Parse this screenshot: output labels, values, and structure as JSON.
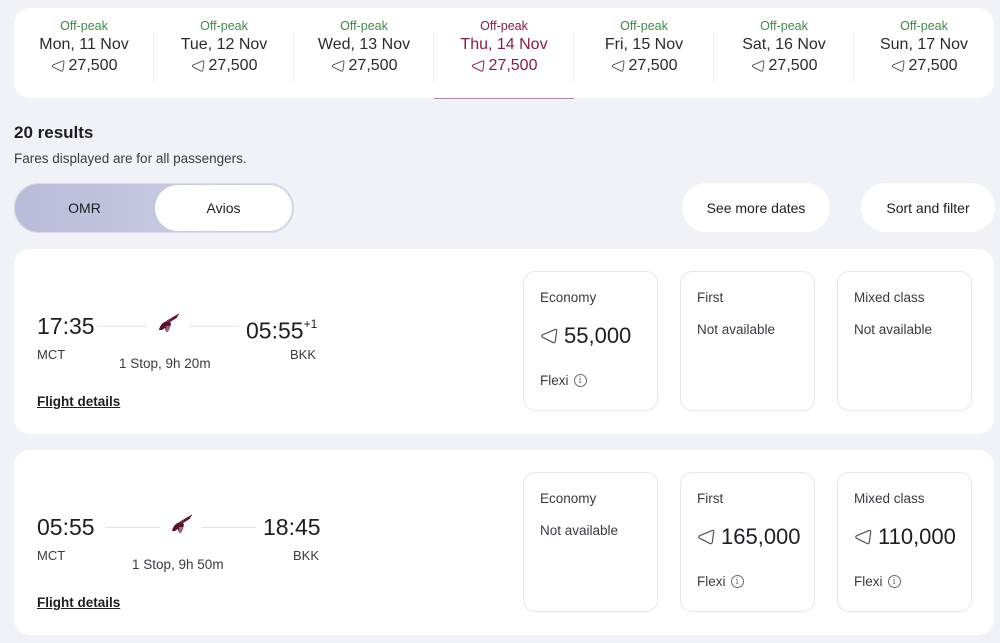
{
  "colors": {
    "accent": "#8b1b45",
    "offpeak": "#3f8a4d",
    "background": "#f1f2f7"
  },
  "date_strip": [
    {
      "peak": "Off-peak",
      "date": "Mon, 11 Nov",
      "price": "27,500",
      "selected": false
    },
    {
      "peak": "Off-peak",
      "date": "Tue, 12 Nov",
      "price": "27,500",
      "selected": false
    },
    {
      "peak": "Off-peak",
      "date": "Wed, 13 Nov",
      "price": "27,500",
      "selected": false
    },
    {
      "peak": "Off-peak",
      "date": "Thu, 14 Nov",
      "price": "27,500",
      "selected": true
    },
    {
      "peak": "Off-peak",
      "date": "Fri, 15 Nov",
      "price": "27,500",
      "selected": false
    },
    {
      "peak": "Off-peak",
      "date": "Sat, 16 Nov",
      "price": "27,500",
      "selected": false
    },
    {
      "peak": "Off-peak",
      "date": "Sun, 17 Nov",
      "price": "27,500",
      "selected": false
    }
  ],
  "results": {
    "count_label": "20 results",
    "subtitle": "Fares displayed are for all passengers."
  },
  "currency_toggle": {
    "options": [
      "OMR",
      "Avios"
    ],
    "selected": "Avios"
  },
  "actions": {
    "see_more_dates": "See more dates",
    "sort_and_filter": "Sort and filter"
  },
  "icons": {
    "price_currency": "avios-icon",
    "airline": "qatar-oryx-logo-icon",
    "fare_info": "info-icon"
  },
  "flights": [
    {
      "departure_time": "17:35",
      "arrival_time": "05:55",
      "day_offset": "+1",
      "from": "MCT",
      "to": "BKK",
      "stops": "1 Stop, 9h 20m",
      "details_link": "Flight details",
      "fares": [
        {
          "class": "Economy",
          "available": true,
          "price": "55,000",
          "fare_type": "Flexi",
          "na_label": ""
        },
        {
          "class": "First",
          "available": false,
          "price": "",
          "fare_type": "",
          "na_label": "Not available"
        },
        {
          "class": "Mixed class",
          "available": false,
          "price": "",
          "fare_type": "",
          "na_label": "Not available"
        }
      ]
    },
    {
      "departure_time": "05:55",
      "arrival_time": "18:45",
      "day_offset": "",
      "from": "MCT",
      "to": "BKK",
      "stops": "1 Stop, 9h 50m",
      "details_link": "Flight details",
      "fares": [
        {
          "class": "Economy",
          "available": false,
          "price": "",
          "fare_type": "",
          "na_label": "Not available"
        },
        {
          "class": "First",
          "available": true,
          "price": "165,000",
          "fare_type": "Flexi",
          "na_label": ""
        },
        {
          "class": "Mixed class",
          "available": true,
          "price": "110,000",
          "fare_type": "Flexi",
          "na_label": ""
        }
      ]
    }
  ]
}
